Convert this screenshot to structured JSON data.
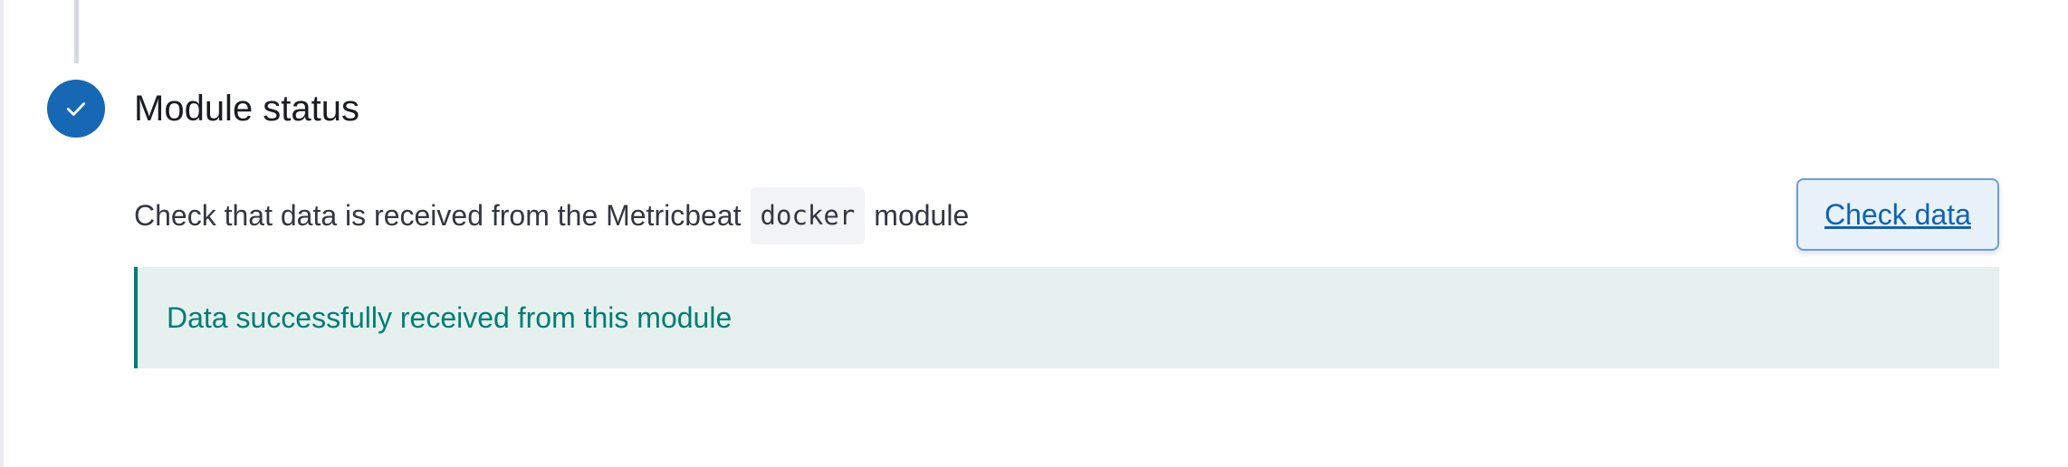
{
  "step": {
    "title": "Module status",
    "status": "complete",
    "icon": "check-icon",
    "badge_color": "#1668b5"
  },
  "description": {
    "prefix": "Check that data is received from the Metricbeat",
    "module_name": "docker",
    "suffix": "module"
  },
  "button": {
    "label": "Check data"
  },
  "callout": {
    "message": "Data successfully received from this module",
    "color": "#017d73"
  }
}
